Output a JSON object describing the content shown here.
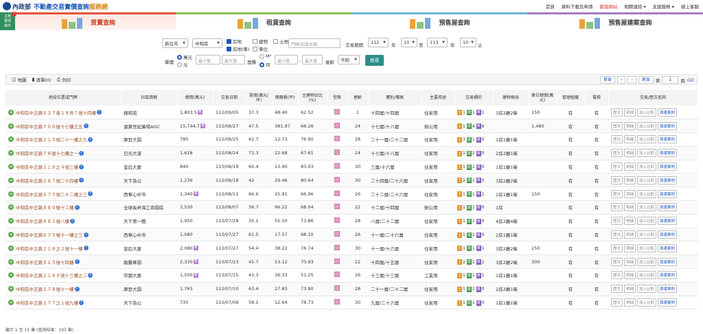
{
  "header": {
    "ministry": "內政部",
    "title_main": "不動產交易實價查詢",
    "title_sub": "服務網",
    "nav": [
      "首頁",
      "資料下載及申請",
      "舊版網站",
      "相關連結 ▾",
      "支援服務 ▾",
      "線上客服"
    ]
  },
  "side_badge": {
    "label": "主題\n選項\n條件",
    "count": "!"
  },
  "tabs": [
    {
      "label": "買賣查詢"
    },
    {
      "label": "租賃查詢"
    },
    {
      "label": "預售屋查詢"
    },
    {
      "label": "預售屋建案查詢"
    }
  ],
  "filters": {
    "city": "新北市",
    "district": "中和區",
    "types": [
      {
        "label": "房地",
        "checked": true
      },
      {
        "label": "建物",
        "checked": false
      },
      {
        "label": "土地",
        "checked": false
      },
      {
        "label": "房地(車)",
        "checked": true
      },
      {
        "label": "車位",
        "checked": false
      }
    ],
    "address_placeholder": "門牌/社區名稱",
    "period_label": "交易期間",
    "year_from": "112",
    "month_from": "10",
    "year_to": "113",
    "month_to": "10",
    "year_unit": "年",
    "to_label": "至",
    "end_label": "止",
    "price_label": "單價",
    "price_units": [
      "萬元",
      "元"
    ],
    "price_unit_selected": "萬元",
    "area_label": "面積",
    "area_units": [
      "M²",
      "坪"
    ],
    "area_unit_selected": "坪",
    "min_placeholder": "最小值",
    "max_placeholder": "最大值",
    "dash": "-",
    "age_label": "屋齡",
    "age_value": "不拘",
    "search_button": "搜尋"
  },
  "toolbar": {
    "map": "地圖",
    "list": "清單(0)",
    "print": "列印",
    "first": "首頁",
    "prev": "‹",
    "next": "›",
    "last": "尾頁",
    "page_prefix": "第",
    "page_value": "1",
    "page_suffix": "頁",
    "go": "GO"
  },
  "table": {
    "headers": [
      "地段位置或門牌",
      "社區簡稱",
      "總價(萬元)",
      "交易日期",
      "單價(萬元/坪)",
      "總面積(坪)",
      "主建物佔比(%)",
      "型態",
      "屋齡",
      "樓別/樓高",
      "主要用途",
      "交易標的",
      "建物格局",
      "車位總價(萬元)",
      "管理組織",
      "電梯",
      "交易/歷次查詢"
    ],
    "actions": [
      "歷次",
      "明細",
      "加入比較",
      "周邊案例"
    ],
    "rows": [
      {
        "addr": "中和區中正路６３７巷１８弄７號十四樓",
        "name": "錦和苑",
        "price": "1,803.5",
        "ptag": true,
        "date": "113/09/05",
        "unit": "37.3",
        "area": "48.40",
        "main": "62.52",
        "age": "1",
        "floor": "十四層/十四層",
        "use": "住家用",
        "t": [
          "1",
          "1",
          "1"
        ],
        "layout": "3房2廳2衛",
        "park": "150",
        "mgmt": "有",
        "elev": "有"
      },
      {
        "addr": "中和區中正路７００號十七樓之五",
        "name": "遠東世紀廣場AOC",
        "price": "15,744.7",
        "ptag": true,
        "date": "113/08/27",
        "unit": "47.5",
        "area": "381.97",
        "main": "66.26",
        "age": "24",
        "floor": "十七層/十八層",
        "use": "辦公用",
        "t": [
          "1",
          "4",
          "6"
        ],
        "layout": "",
        "park": "1,480",
        "mgmt": "有",
        "elev": "有"
      },
      {
        "addr": "中和區中正路２１５號二十一樓之九",
        "name": "摩登大園",
        "price": "785",
        "ptag": false,
        "date": "113/08/25",
        "unit": "61.7",
        "area": "12.73",
        "main": "76.90",
        "age": "28",
        "floor": "二十一層/二十二層",
        "use": "住家用",
        "t": [
          "3",
          "1",
          "0"
        ],
        "layout": "1房1廳1衛",
        "park": "",
        "mgmt": "有",
        "elev": "有"
      },
      {
        "addr": "中和區中正路７８號十七樓之一",
        "name": "日光大道",
        "price": "1,618",
        "ptag": false,
        "date": "113/08/24",
        "unit": "71.3",
        "area": "22.68",
        "main": "67.61",
        "age": "24",
        "floor": "十七層/十八層",
        "use": "住家用",
        "t": [
          "1",
          "1",
          "0"
        ],
        "layout": "2房2廳1衛",
        "park": "",
        "mgmt": "有",
        "elev": "有"
      },
      {
        "addr": "中和區中正路２１８之４號三樓",
        "name": "皇后大廈",
        "price": "840",
        "ptag": false,
        "date": "113/08/19",
        "unit": "60.4",
        "area": "13.90",
        "main": "83.03",
        "age": "30",
        "floor": "三層/十六層",
        "use": "住家用",
        "t": [
          "1",
          "1",
          "0"
        ],
        "layout": "1房1廳1衛",
        "park": "",
        "mgmt": "有",
        "elev": "有"
      },
      {
        "addr": "中和區中正路２６７號二十四樓",
        "name": "天下為公",
        "price": "1,236",
        "ptag": false,
        "date": "113/08/18",
        "unit": "42",
        "area": "29.46",
        "main": "80.64",
        "age": "30",
        "floor": "二十四層/二十六層",
        "use": "住家用",
        "t": [
          "2",
          "1",
          "0"
        ],
        "layout": "3房2廳2衛",
        "park": "",
        "mgmt": "有",
        "elev": "有"
      },
      {
        "addr": "中和區中正路６７５號二十二樓之三",
        "name": "西華心中市",
        "price": "1,340",
        "ptag": true,
        "date": "113/08/11",
        "unit": "66.6",
        "area": "25.91",
        "main": "66.96",
        "age": "26",
        "floor": "二十二層/二十六層",
        "use": "住家用",
        "t": [
          "1",
          "1",
          "1"
        ],
        "layout": "2房1廳1衛",
        "park": "150",
        "mgmt": "有",
        "elev": "有"
      },
      {
        "addr": "中和區中正路８８０號十二樓",
        "name": "全球長昇海工商園區",
        "price": "3,530",
        "ptag": false,
        "date": "113/08/07",
        "unit": "36.7",
        "area": "96.22",
        "main": "68.04",
        "age": "22",
        "floor": "十二層/十四層",
        "use": "辦公用",
        "t": [
          "1",
          "1",
          "0"
        ],
        "layout": "1房",
        "park": "",
        "mgmt": "有",
        "elev": "有"
      },
      {
        "addr": "中和區中正路８８１號八樓",
        "name": "天下第一關",
        "price": "1,950",
        "ptag": false,
        "date": "113/07/28",
        "unit": "35.1",
        "area": "55.50",
        "main": "73.86",
        "age": "28",
        "floor": "八層/二十二層",
        "use": "住家用",
        "t": [
          "1",
          "1",
          "0"
        ],
        "layout": "4房2廳4衛",
        "park": "",
        "mgmt": "有",
        "elev": "有"
      },
      {
        "addr": "中和區中正路６７５號十一樓之三",
        "name": "西華心中市",
        "price": "1,080",
        "ptag": false,
        "date": "113/07/27",
        "unit": "61.5",
        "area": "17.57",
        "main": "68.10",
        "age": "26",
        "floor": "十一層/二十六層",
        "use": "住家用",
        "t": [
          "1",
          "1",
          "0"
        ],
        "layout": "2房1廳1衛",
        "park": "",
        "mgmt": "有",
        "elev": "有"
      },
      {
        "addr": "中和區中正路２１８之２號十一樓",
        "name": "皇后大廈",
        "price": "2,080",
        "ptag": true,
        "date": "113/07/27",
        "unit": "54.4",
        "area": "38.22",
        "main": "76.74",
        "age": "30",
        "floor": "十一層/十六層",
        "use": "住家用",
        "t": [
          "1",
          "1",
          "1"
        ],
        "layout": "3房2廳2衛",
        "park": "250",
        "mgmt": "有",
        "elev": "有"
      },
      {
        "addr": "中和區中正路５１５號十四樓",
        "name": "龍騰華園",
        "price": "2,330",
        "ptag": true,
        "date": "113/07/23",
        "unit": "45.7",
        "area": "53.12",
        "main": "70.93",
        "age": "22",
        "floor": "十四層/十五層",
        "use": "住家用",
        "t": [
          "2",
          "1",
          "2"
        ],
        "layout": "3房2廳2衛",
        "park": "300",
        "mgmt": "有",
        "elev": "有"
      },
      {
        "addr": "中和區中正路１１８０號十三樓之二",
        "name": "帝國大廈",
        "price": "1,500",
        "ptag": true,
        "date": "113/07/15",
        "unit": "41.3",
        "area": "36.33",
        "main": "51.25",
        "age": "26",
        "floor": "十三層/十三層",
        "use": "工業用",
        "t": [
          "1",
          "1",
          "1"
        ],
        "layout": "1房1廳1衛",
        "park": "",
        "mgmt": "有",
        "elev": "有"
      },
      {
        "addr": "中和區中正路１７８號十一樓",
        "name": "摩登大園",
        "price": "1,765",
        "price_": "",
        "ptag": false,
        "date": "113/07/10",
        "unit": "63.4",
        "area": "27.83",
        "main": "73.90",
        "age": "28",
        "floor": "二十一層/二十二層",
        "use": "住家用",
        "t": [
          "1",
          "1",
          "0"
        ],
        "layout": "2房2廳1衛",
        "park": "",
        "mgmt": "有",
        "elev": "有"
      },
      {
        "addr": "中和區中正路２７７之１號九樓",
        "name": "天下為公",
        "price": "735",
        "ptag": false,
        "date": "113/07/09",
        "unit": "58.1",
        "area": "12.64",
        "main": "78.73",
        "age": "30",
        "floor": "九層/二十六層",
        "use": "住家用",
        "t": [
          "1",
          "1",
          "0"
        ],
        "layout": "1房1廳1衛",
        "park": "",
        "mgmt": "有",
        "elev": "有"
      }
    ]
  },
  "footer": "顯示 1 至 15 筆 (查詢結果：193 筆)",
  "colors": {
    "accent": "#2b8f8a",
    "link": "#1a56b8",
    "address": "#a0522d",
    "buy_tab": "#e5533c"
  }
}
